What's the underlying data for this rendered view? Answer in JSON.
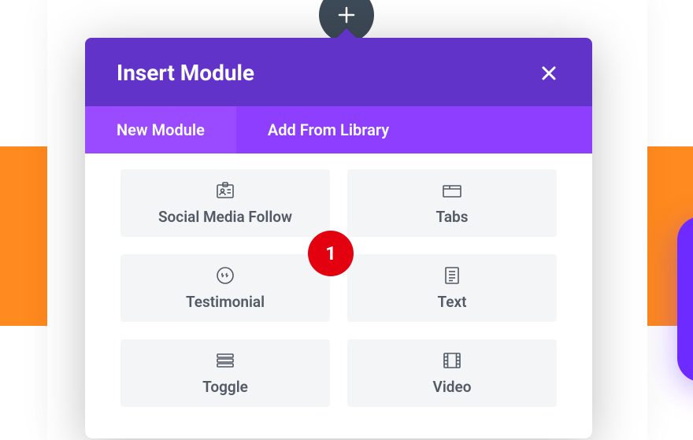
{
  "modal": {
    "title": "Insert Module",
    "tabs": {
      "new": "New Module",
      "library": "Add From Library"
    },
    "modules": {
      "social": "Social Media Follow",
      "tabs": "Tabs",
      "testimonial": "Testimonial",
      "text": "Text",
      "toggle": "Toggle",
      "video": "Video"
    }
  },
  "annotation": {
    "badge1": "1"
  }
}
